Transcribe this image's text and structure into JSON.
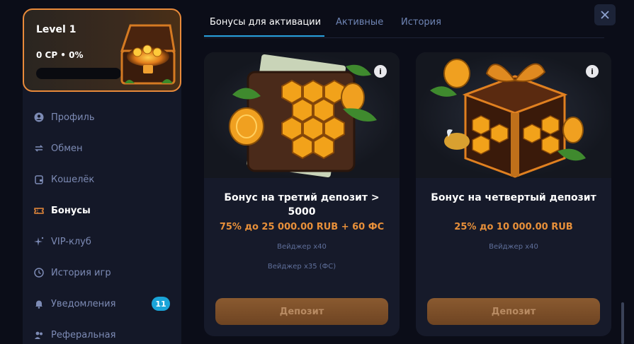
{
  "level": {
    "title": "Level 1",
    "points": "0 CP • 0%",
    "progress_percent": 0
  },
  "nav": {
    "items": [
      {
        "label": "Профиль",
        "icon": "user-icon"
      },
      {
        "label": "Обмен",
        "icon": "exchange-icon"
      },
      {
        "label": "Кошелёк",
        "icon": "wallet-icon"
      },
      {
        "label": "Бонусы",
        "icon": "ticket-icon",
        "active": true
      },
      {
        "label": "VIP-клуб",
        "icon": "sparkle-icon"
      },
      {
        "label": "История игр",
        "icon": "clock-icon"
      },
      {
        "label": "Уведомления",
        "icon": "bell-icon",
        "badge": "11"
      },
      {
        "label": "Реферальная",
        "icon": "users-icon"
      }
    ]
  },
  "tabs": [
    {
      "label": "Бонусы для активации",
      "active": true
    },
    {
      "label": "Активные"
    },
    {
      "label": "История"
    }
  ],
  "cards": [
    {
      "title": "Бонус на третий депозит > 5000",
      "amount": "75% до 25 000.00 RUB + 60 ФС",
      "wager": "Вейджер x40",
      "wager2": "Вейджер x35 (ФС)",
      "button": "Депозит",
      "info": "i"
    },
    {
      "title": "Бонус на четвертый депозит",
      "amount": "25% до 10 000.00 RUB",
      "wager": "Вейджер x40",
      "button": "Депозит",
      "info": "i"
    }
  ],
  "colors": {
    "accent": "#e98a3a",
    "tab_underline": "#2aa3e0",
    "badge": "#1aa4d8",
    "background": "#0b0d18"
  }
}
